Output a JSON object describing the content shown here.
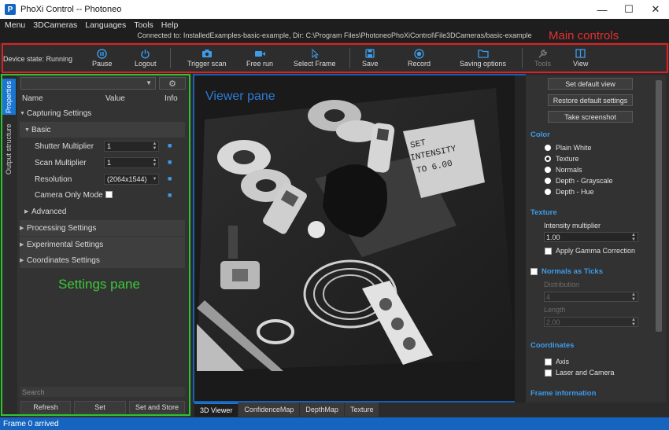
{
  "window": {
    "title": "PhoXi Control -- Photoneo",
    "logo_letter": "P"
  },
  "menu": [
    "Menu",
    "3DCameras",
    "Languages",
    "Tools",
    "Help"
  ],
  "connection_text": "Connected to: InstalledExamples-basic-example, Dir: C:\\Program Files\\PhotoneoPhoXiControl\\File3DCameras/basic-example",
  "annotations": {
    "main_controls": "Main controls",
    "settings_pane": "Settings pane",
    "viewer_pane": "Viewer pane"
  },
  "toolbar": {
    "device_state": "Device state: Running",
    "pause": "Pause",
    "logout": "Logout",
    "trigger_scan": "Trigger scan",
    "free_run": "Free run",
    "select_frame": "Select Frame",
    "save": "Save",
    "record": "Record",
    "saving_options": "Saving options",
    "tools": "Tools",
    "view": "View"
  },
  "side_tabs": [
    "Properties",
    "Output structure"
  ],
  "settings": {
    "headers": {
      "name": "Name",
      "value": "Value",
      "info": "Info"
    },
    "capturing": "Capturing Settings",
    "basic": "Basic",
    "shutter_label": "Shutter Multiplier",
    "shutter_value": "1",
    "scan_label": "Scan Multiplier",
    "scan_value": "1",
    "resolution_label": "Resolution",
    "resolution_value": "(2064x1544)",
    "camera_only_label": "Camera Only Mode",
    "advanced": "Advanced",
    "processing": "Processing Settings",
    "experimental": "Experimental Settings",
    "coordinates": "Coordinates Settings",
    "search_placeholder": "Search",
    "refresh": "Refresh",
    "set": "Set",
    "set_and_store": "Set and Store"
  },
  "viewer_tabs": [
    "3D Viewer",
    "ConfidenceMap",
    "DepthMap",
    "Texture"
  ],
  "right_panel": {
    "set_default_view": "Set default view",
    "restore_default_settings": "Restore default settings",
    "take_screenshot": "Take screenshot",
    "color_title": "Color",
    "color_options": [
      "Plain White",
      "Texture",
      "Normals",
      "Depth - Grayscale",
      "Depth - Hue"
    ],
    "color_selected": "Texture",
    "texture_title": "Texture",
    "intensity_label": "Intensity multiplier",
    "intensity_value": "1.00",
    "gamma_label": "Apply Gamma Correction",
    "normals_title": "Normals as Ticks",
    "distribution_label": "Distribution",
    "distribution_value": "4",
    "length_label": "Length",
    "length_value": "2.00",
    "coordinates_title": "Coordinates",
    "axis_label": "Axis",
    "laser_label": "Laser and Camera",
    "frame_info_title": "Frame information"
  },
  "scene_text": {
    "sign": "SET\nINTENSITY\nTO 6.00"
  },
  "status": "Frame 0 arrived",
  "colors": {
    "accent": "#1976d2",
    "main_box": "#e02020",
    "settings_box": "#2ec52e",
    "viewer_box": "#1a5fb4"
  }
}
